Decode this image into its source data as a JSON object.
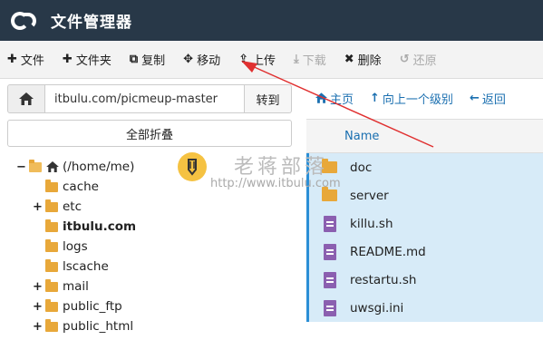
{
  "app": {
    "title": "文件管理器"
  },
  "toolbar": {
    "items": [
      {
        "label": "文件",
        "icon": "plus-icon",
        "disabled": false
      },
      {
        "label": "文件夹",
        "icon": "plus-icon",
        "disabled": false
      },
      {
        "label": "复制",
        "icon": "copy-icon",
        "disabled": false
      },
      {
        "label": "移动",
        "icon": "move-icon",
        "disabled": false
      },
      {
        "label": "上传",
        "icon": "upload-icon",
        "disabled": false
      },
      {
        "label": "下载",
        "icon": "download-icon",
        "disabled": true
      },
      {
        "label": "删除",
        "icon": "delete-icon",
        "disabled": false
      },
      {
        "label": "还原",
        "icon": "restore-icon",
        "disabled": true
      }
    ]
  },
  "path": {
    "value": "itbulu.com/picmeup-master",
    "go_label": "转到"
  },
  "collapse_label": "全部折叠",
  "tree": [
    {
      "label": "(/home/me)",
      "toggle": "−",
      "level": 0,
      "bold": false,
      "home": true
    },
    {
      "label": "cache",
      "toggle": "",
      "level": 1,
      "bold": false
    },
    {
      "label": "etc",
      "toggle": "+",
      "level": 1,
      "bold": false
    },
    {
      "label": "itbulu.com",
      "toggle": "",
      "level": 1,
      "bold": true
    },
    {
      "label": "logs",
      "toggle": "",
      "level": 1,
      "bold": false
    },
    {
      "label": "lscache",
      "toggle": "",
      "level": 1,
      "bold": false
    },
    {
      "label": "mail",
      "toggle": "+",
      "level": 1,
      "bold": false
    },
    {
      "label": "public_ftp",
      "toggle": "+",
      "level": 1,
      "bold": false
    },
    {
      "label": "public_html",
      "toggle": "+",
      "level": 1,
      "bold": false
    }
  ],
  "nav": {
    "home": "主页",
    "up": "向上一个级别",
    "back": "返回"
  },
  "list": {
    "column_name": "Name",
    "files": [
      {
        "name": "doc",
        "type": "folder"
      },
      {
        "name": "server",
        "type": "folder"
      },
      {
        "name": "killu.sh",
        "type": "file"
      },
      {
        "name": "README.md",
        "type": "file"
      },
      {
        "name": "restartu.sh",
        "type": "file"
      },
      {
        "name": "uwsgi.ini",
        "type": "file"
      }
    ]
  },
  "watermark": {
    "title": "老蒋部落",
    "url": "http://www.itbulu.com"
  },
  "colors": {
    "topbar": "#283848",
    "accent": "#1a6fb0",
    "selected_row": "#d7ebf8",
    "folder": "#e8a83a",
    "file": "#8b5fb0",
    "annotation_arrow": "#e03030"
  }
}
